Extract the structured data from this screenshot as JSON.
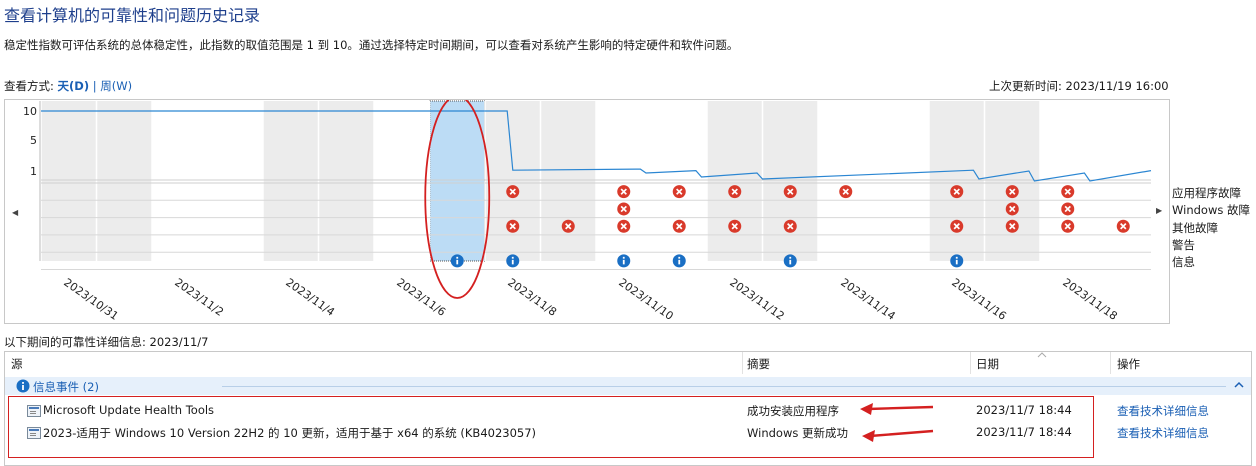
{
  "header": {
    "title": "查看计算机的可靠性和问题历史记录",
    "description": "稳定性指数可评估系统的总体稳定性，此指数的取值范围是 1 到 10。通过选择特定时间期间，可以查看对系统产生影响的特定硬件和软件问题。",
    "view_label": "查看方式:",
    "view_day": "天(D)",
    "view_sep": "|",
    "view_week": "周(W)",
    "last_updated": "上次更新时间: 2023/11/19 16:00"
  },
  "chart": {
    "y_ticks": [
      "10",
      "5",
      "1"
    ],
    "date_labels": [
      "2023/10/31",
      "2023/11/2",
      "2023/11/4",
      "2023/11/6",
      "2023/11/8",
      "2023/11/10",
      "2023/11/12",
      "2023/11/14",
      "2023/11/16",
      "2023/11/18"
    ],
    "selected_index": 7,
    "stability_curve": [
      {
        "i": 0,
        "v": 10
      },
      {
        "i": 8.4,
        "v": 10
      },
      {
        "i": 8.5,
        "v": 1.1
      },
      {
        "i": 10.8,
        "v": 1.25
      },
      {
        "i": 10.9,
        "v": 0.95
      },
      {
        "i": 11.8,
        "v": 1.05
      },
      {
        "i": 11.9,
        "v": 0.85
      },
      {
        "i": 12.9,
        "v": 0.95
      },
      {
        "i": 13.0,
        "v": 0.8
      },
      {
        "i": 16.8,
        "v": 1.1
      },
      {
        "i": 16.9,
        "v": 0.8
      },
      {
        "i": 17.8,
        "v": 1.0
      },
      {
        "i": 17.9,
        "v": 0.75
      },
      {
        "i": 18.8,
        "v": 0.95
      },
      {
        "i": 18.9,
        "v": 0.75
      },
      {
        "i": 20,
        "v": 1.05
      }
    ],
    "events": {
      "app_failures": [
        8,
        10,
        11,
        12,
        13,
        14,
        16,
        17,
        18
      ],
      "windows_failures": [
        10,
        17,
        18
      ],
      "misc_failures": [
        8,
        9,
        10,
        11,
        12,
        13,
        16,
        17,
        18,
        19
      ],
      "warnings": [],
      "info": [
        7,
        8,
        10,
        11,
        13,
        16
      ]
    },
    "colors": {
      "curve": "#2b86d2",
      "selected": "#bcdcf5",
      "shade": "#ececec",
      "error": "#d93a2b",
      "info": "#1a6fc4",
      "annotation": "#d42020"
    },
    "legend": [
      "应用程序故障",
      "Windows 故障",
      "其他故障",
      "警告",
      "信息"
    ]
  },
  "details": {
    "label": "以下期间的可靠性详细信息: 2023/11/7",
    "columns": {
      "source": "源",
      "summary": "摘要",
      "date": "日期",
      "action": "操作"
    },
    "group": "信息事件 (2)",
    "rows": [
      {
        "source": "Microsoft Update Health Tools",
        "summary": "成功安装应用程序",
        "date": "2023/11/7 18:44",
        "action": "查看技术详细信息"
      },
      {
        "source": "2023-适用于 Windows 10 Version 22H2 的 10 更新，适用于基于 x64 的系统 (KB4023057)",
        "summary": "Windows 更新成功",
        "date": "2023/11/7 18:44",
        "action": "查看技术详细信息"
      }
    ]
  },
  "icons": [
    "chevron-left-icon",
    "chevron-right-icon",
    "error-icon",
    "info-icon",
    "collapse-icon",
    "sort-arrow-icon",
    "event-row-icon"
  ]
}
